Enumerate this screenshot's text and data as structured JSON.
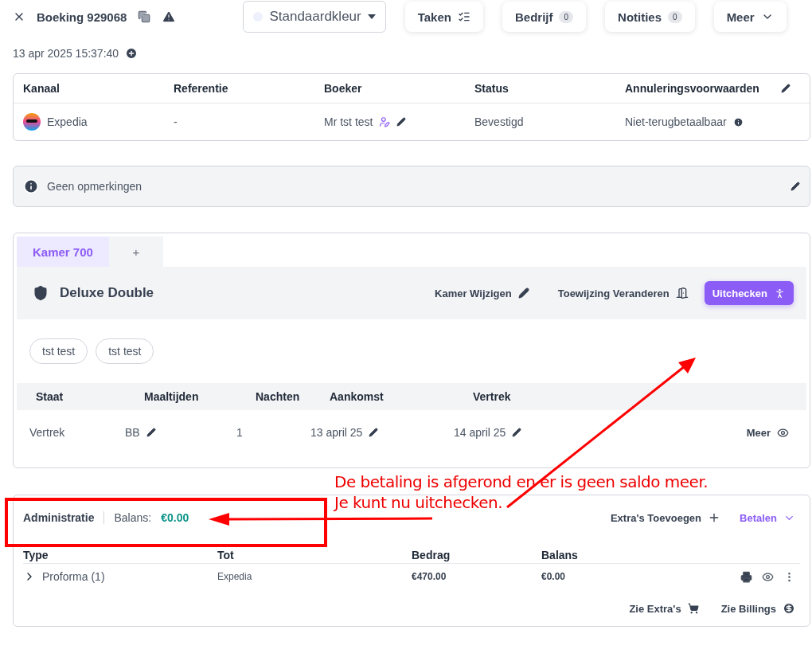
{
  "header": {
    "title": "Boeking 929068",
    "color_select": "Standaardkleur",
    "buttons": [
      {
        "kind": "tasks",
        "label": "Taken"
      },
      {
        "kind": "count",
        "label": "Bedrijf",
        "count": "0"
      },
      {
        "kind": "count",
        "label": "Notities",
        "count": "0"
      },
      {
        "kind": "menu",
        "label": "Meer"
      }
    ],
    "created": "13 apr 2025 15:37:40"
  },
  "booking": {
    "columns": [
      "Kanaal",
      "Referentie",
      "Boeker",
      "Status",
      "Annuleringsvoorwaarden"
    ],
    "channel": "Expedia",
    "reference": "-",
    "booker": "Mr tst test",
    "status": "Bevestigd",
    "cancellation": "Niet-terugbetaalbaar"
  },
  "notes": {
    "text": "Geen opmerkingen"
  },
  "room": {
    "tabs": [
      {
        "label": "Kamer 700",
        "selected": true
      },
      {
        "label": "+",
        "selected": false
      }
    ],
    "name": "Deluxe Double",
    "actions": [
      {
        "kind": "edit",
        "label": "Kamer Wijzigen"
      },
      {
        "kind": "door",
        "label": "Toewijzing Veranderen"
      }
    ],
    "checkout": "Uitchecken",
    "guests": [
      "tst test",
      "tst test"
    ],
    "columns": [
      "Staat",
      "Maaltijden",
      "Nachten",
      "Aankomst",
      "Vertrek"
    ],
    "row": [
      {
        "text": "Vertrek",
        "editable": false
      },
      {
        "text": "BB",
        "editable": true
      },
      {
        "text": "1",
        "editable": false
      },
      {
        "text": "13 april 25",
        "editable": true
      },
      {
        "text": "14 april 25",
        "editable": true
      }
    ],
    "more": "Meer"
  },
  "administration": {
    "title": "Administratie",
    "balance_label": "Balans:",
    "balance": "€0.00",
    "add_extras": "Extra's Toevoegen",
    "pay": "Betalen",
    "columns": [
      "Type",
      "Tot",
      "Bedrag",
      "Balans"
    ],
    "rows": [
      {
        "type": "Proforma (1)",
        "expanded": false,
        "to": "Expedia",
        "amount": "€470.00",
        "balance": "€0.00"
      }
    ],
    "links": [
      {
        "kind": "cart",
        "label": "Zie Extra's"
      },
      {
        "kind": "coin",
        "label": "Zie Billings"
      }
    ]
  },
  "annotation": {
    "lines": [
      "De betaling is afgerond en er is geen saldo meer.",
      "Je kunt nu uitchecken."
    ]
  }
}
